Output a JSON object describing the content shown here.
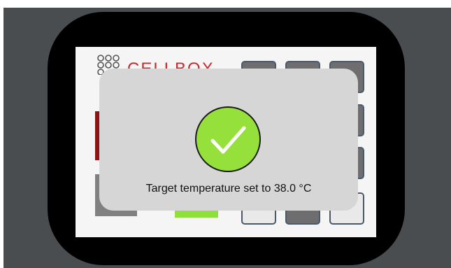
{
  "device": {
    "logo": {
      "brand_text": "CELLBOX",
      "brand_color": "#cc2a2a"
    },
    "colors": {
      "bezel": "#000000",
      "backdrop": "#4a4d50",
      "dialog_bg": "#d6d6d6",
      "success_green": "#96e03c"
    }
  },
  "dialog": {
    "icon": "checkmark-icon",
    "message": "Target temperature set to 38.0 °C"
  }
}
